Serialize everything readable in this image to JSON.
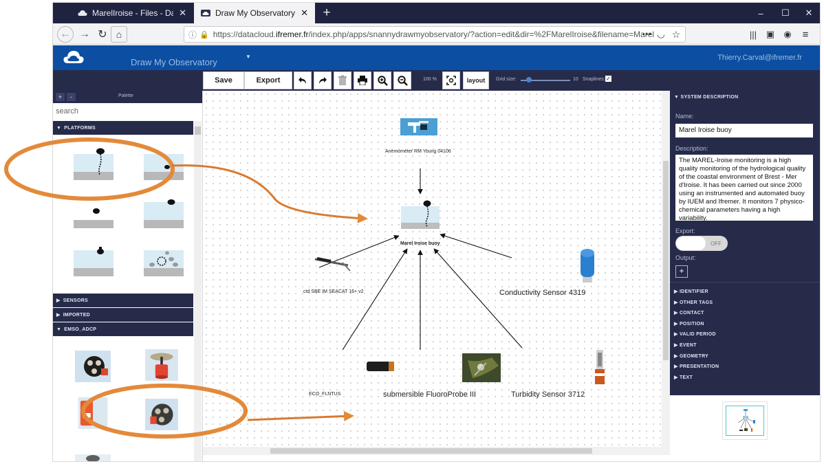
{
  "browser": {
    "tabs": [
      {
        "title": "MarelIroise - Files - Datacloud",
        "close": "✕"
      },
      {
        "title": "Draw My Observatory - Datacl",
        "close": "✕"
      }
    ],
    "new_tab": "+",
    "window_controls": {
      "minimize": "‒",
      "maximize": "☐",
      "close": "✕"
    },
    "url_prefix": "https://datacloud.",
    "url_host": "ifremer.fr",
    "url_rest": "/index.php/apps/snannydrawmyobservatory/?action=edit&dir=%2FMarelIroise&filename=Marel",
    "url_ellipsis": "•••"
  },
  "app": {
    "title": "Draw My Observatory",
    "user": "Thierry.Carval@ifremer.fr"
  },
  "toolbar": {
    "save": "Save",
    "export": "Export",
    "zoom": "100 %",
    "layout": "layout",
    "grid_size_label": "Grid size:",
    "grid_size_value": "10",
    "snaplines_label": "Snaplines:",
    "snaplines_checked": "✓"
  },
  "palette": {
    "title": "Palette",
    "plus": "+",
    "minus": "-",
    "search_placeholder": "search",
    "sections": {
      "platforms": "PLATFORMS",
      "sensors": "SENSORS",
      "imported": "IMPORTED",
      "emso_adcp": "EMSO_ADCP"
    }
  },
  "canvas": {
    "nodes": {
      "anemometer": "Anemometer RM Young 04106",
      "buoy": "Marel Iroise buoy",
      "ctd": "ctd SBE IM SEACAT 16+ v2",
      "conductivity": "Conductivity Sensor 4319",
      "eco": "ECO_FLNTUS",
      "fluoroprobe": "submersible FluoroProbe III",
      "turbidity": "Turbidity Sensor 3712"
    }
  },
  "panel": {
    "header": "SYSTEM DESCRIPTION",
    "name_label": "Name:",
    "name_value": "Marel Iroise buoy",
    "description_label": "Description:",
    "description_value": "The MAREL-Iroise monitoring is a high quality monitoring of the hydrological quality of the coastal environment of Brest - Mer d'Iroise. It has been carried out since 2000 using an instrumented and automated buoy by IUEM and Ifremer. It monitors 7 physico-chemical parameters having a high variability.",
    "export_label": "Export:",
    "export_state": "OFF",
    "output_label": "Output:",
    "output_add": "+",
    "sections": [
      "IDENTIFIER",
      "OTHER TAGS",
      "CONTACT",
      "POSITION",
      "VALID PERIOD",
      "EVENT",
      "GEOMETRY",
      "PRESENTATION",
      "TEXT"
    ]
  },
  "colors": {
    "app_header": "#0b4ea2",
    "dark_panel": "#262b4a",
    "annotation_orange": "#e38a3a",
    "minimap_view": "#4fc5c5"
  }
}
